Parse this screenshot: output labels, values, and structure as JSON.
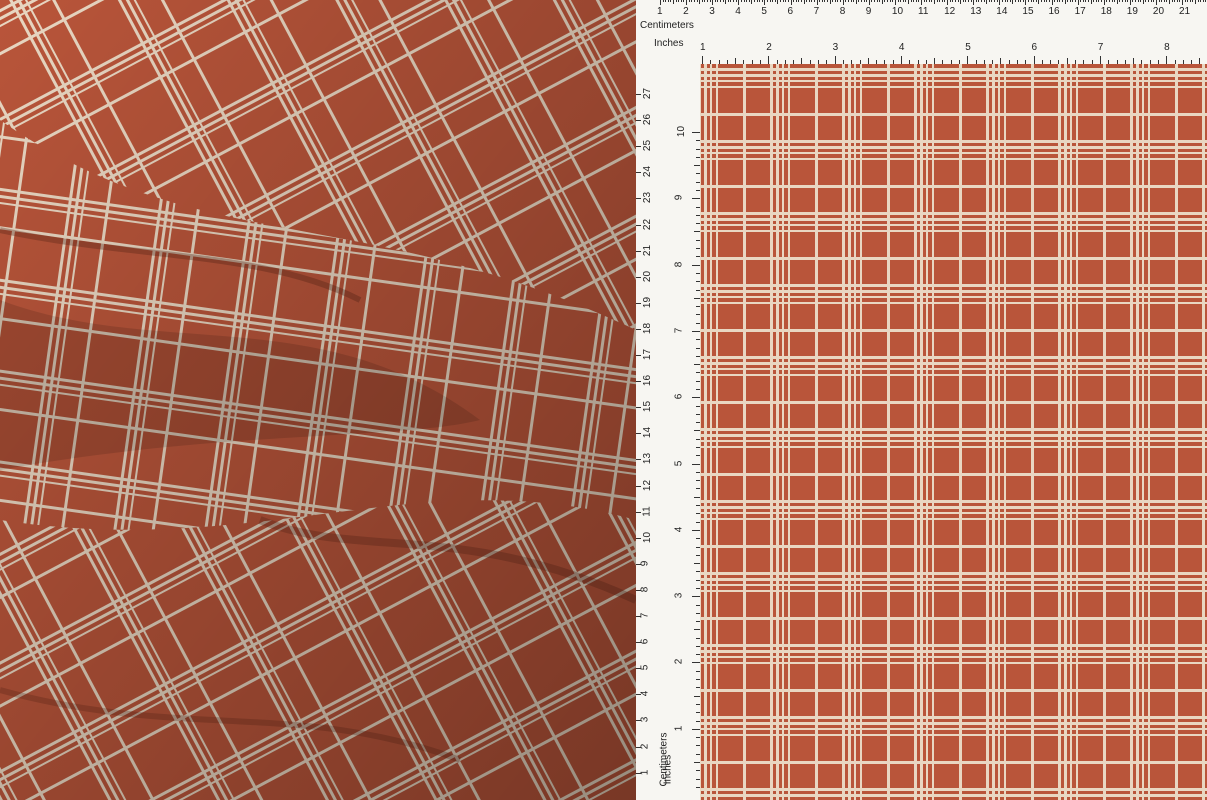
{
  "fabric": {
    "base_color": "#b9553a",
    "shade_color": "#8f3c27",
    "line_color": "#e9d7c2"
  },
  "ruler": {
    "cm_label": "Centimeters",
    "in_label": "Inches",
    "cm_top": [
      "1",
      "2",
      "3",
      "4",
      "5",
      "6",
      "7",
      "8",
      "9",
      "10",
      "11",
      "12",
      "13",
      "14",
      "15",
      "16",
      "17",
      "18",
      "19",
      "20",
      "21"
    ],
    "in_top": [
      "1",
      "2",
      "3",
      "4",
      "5",
      "6",
      "7",
      "8"
    ],
    "cm_left": [
      "27",
      "26",
      "25",
      "24",
      "23",
      "22",
      "21",
      "20",
      "19",
      "18",
      "17",
      "16",
      "15",
      "14",
      "13",
      "12",
      "11",
      "10",
      "9",
      "8",
      "7",
      "6",
      "5",
      "4",
      "3",
      "2",
      "1"
    ],
    "in_left": [
      "10",
      "9",
      "8",
      "7",
      "6",
      "5",
      "4",
      "3",
      "2",
      "1"
    ],
    "cm_left_label": "Centimeters",
    "in_left_label": "Inches"
  }
}
